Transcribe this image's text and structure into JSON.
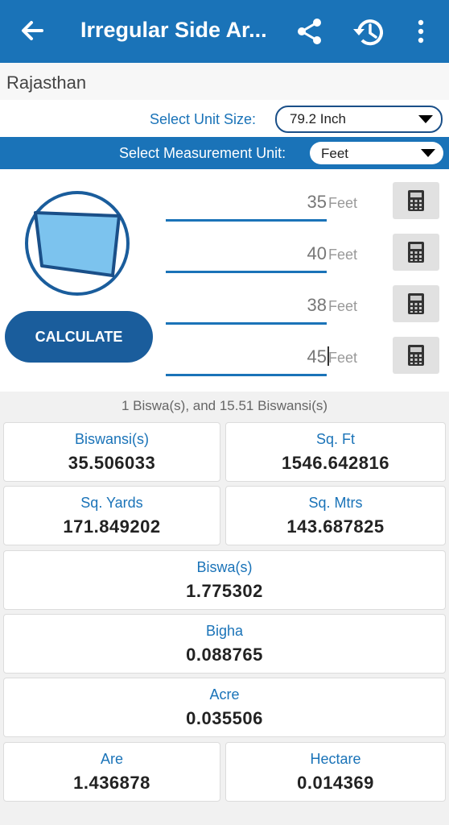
{
  "app_bar": {
    "title": "Irregular Side Ar...",
    "colors": {
      "primary": "#1a73b8",
      "button": "#1a5d9c"
    }
  },
  "state": {
    "name": "Rajasthan"
  },
  "unit_size": {
    "label": "Select Unit Size:",
    "value": "79.2 Inch"
  },
  "measurement_unit": {
    "label": "Select Measurement Unit:",
    "value": "Feet"
  },
  "sides": [
    {
      "value": "35",
      "unit": "Feet"
    },
    {
      "value": "40",
      "unit": "Feet"
    },
    {
      "value": "38",
      "unit": "Feet"
    },
    {
      "value": "45",
      "unit": "Feet"
    }
  ],
  "calculate_label": "CALCULATE",
  "summary": "1 Biswa(s),  and 15.51 Biswansi(s)",
  "results": {
    "biswansi": {
      "label": "Biswansi(s)",
      "value": "35.506033"
    },
    "sqft": {
      "label": "Sq. Ft",
      "value": "1546.642816"
    },
    "sqyards": {
      "label": "Sq. Yards",
      "value": "171.849202"
    },
    "sqmtrs": {
      "label": "Sq. Mtrs",
      "value": "143.687825"
    },
    "biswa": {
      "label": "Biswa(s)",
      "value": "1.775302"
    },
    "bigha": {
      "label": "Bigha",
      "value": "0.088765"
    },
    "acre": {
      "label": "Acre",
      "value": "0.035506"
    },
    "are": {
      "label": "Are",
      "value": "1.436878"
    },
    "hectare": {
      "label": "Hectare",
      "value": "0.014369"
    }
  }
}
